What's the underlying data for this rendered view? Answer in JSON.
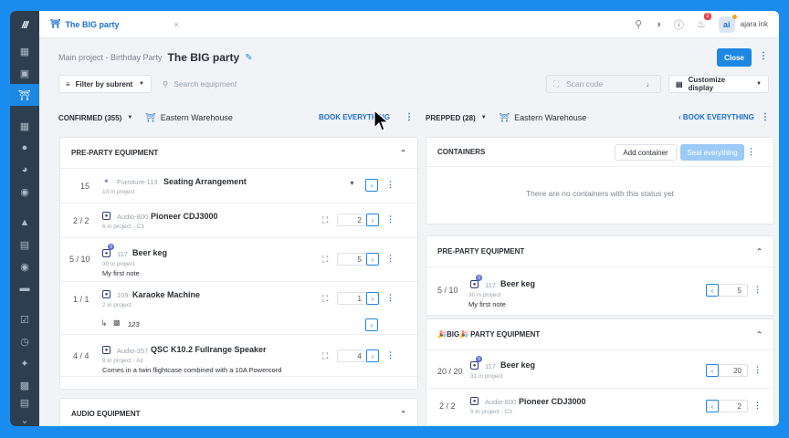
{
  "sidebar": {
    "logo": "///",
    "items": [
      "dashboard-icon",
      "calendar-icon",
      "warehouse-icon",
      "table-icon",
      "contacts-icon",
      "chart-icon",
      "money-icon",
      "shapes-icon",
      "id-card-icon",
      "people-icon",
      "truck-icon",
      "check-icon",
      "clock-icon",
      "wrench-icon",
      "report-icon"
    ],
    "bottom": [
      "chat-icon",
      "expand-icon"
    ]
  },
  "topbar": {
    "tab_title": "The BIG party",
    "tab_close": "×",
    "notifications_count": "2",
    "avatar": "ai",
    "user_name": "ajara ink"
  },
  "header": {
    "breadcrumb": "Main project - Birthday Party",
    "title": "The BIG party",
    "close_label": "Close"
  },
  "toolbar": {
    "filter_label": "Filter by subrent",
    "search_placeholder": "Search equipment",
    "scan_placeholder": "Scan code",
    "customize_label": "Customize display"
  },
  "left": {
    "status_label": "CONFIRMED (355)",
    "warehouse": "Eastern Warehouse",
    "book_label": "BOOK EVERYTHING",
    "section1": {
      "title": "PRE-PARTY EQUIPMENT",
      "rows": [
        {
          "qty": "15",
          "code": "Furniture-113",
          "name": "Seating Arrangement",
          "sub": "13 in project"
        },
        {
          "qty": "2 / 2",
          "code": "Audio-800",
          "name": "Pioneer CDJ3000",
          "sub": "6 in project - C3",
          "value": "2"
        },
        {
          "qty": "5 / 10",
          "badge": "9",
          "code": "117",
          "name": "Beer keg",
          "sub": "30 in project",
          "note": "My first note",
          "value": "5"
        },
        {
          "qty": "1 / 1",
          "code": "109",
          "name": "Karaoke Machine",
          "sub": "2 in project",
          "value": "1"
        },
        {
          "serial": "123"
        },
        {
          "qty": "4 / 4",
          "code": "Audio-357",
          "name": "QSC K10.2 Fullrange Speaker",
          "sub": "8 in project - A1",
          "note": "Comes in a twin flightcase combined with a 10A Powercord",
          "value": "4"
        }
      ]
    },
    "section2": {
      "title": "AUDIO EQUIPMENT"
    }
  },
  "right": {
    "status_label": "PREPPED (28)",
    "warehouse": "Eastern Warehouse",
    "book_label": "BOOK EVERYTHING",
    "containers": {
      "title": "CONTAINERS",
      "add_label": "Add container",
      "seal_label": "Seal everything",
      "empty_text": "There are no containers with this status yet"
    },
    "section1": {
      "title": "PRE-PARTY EQUIPMENT",
      "rows": [
        {
          "qty": "5 / 10",
          "badge": "9",
          "code": "117",
          "name": "Beer keg",
          "sub": "30 in project",
          "note": "My first note",
          "value": "5"
        }
      ]
    },
    "section2": {
      "title": "PARTY EQUIPMENT",
      "title_prefix": "🎉BIG🎉",
      "rows": [
        {
          "qty": "20 / 20",
          "badge": "9",
          "code": "117",
          "name": "Beer keg",
          "sub": "31 in project",
          "value": "20"
        },
        {
          "qty": "2 / 2",
          "code": "Audio-800",
          "name": "Pioneer CDJ3000",
          "sub": "5 in project - C3",
          "value": "2"
        }
      ]
    }
  },
  "icons": {
    "accent": "#1d87e4",
    "sidebar_bg": "#2c3e50",
    "page_bg": "#1a8cf0"
  }
}
